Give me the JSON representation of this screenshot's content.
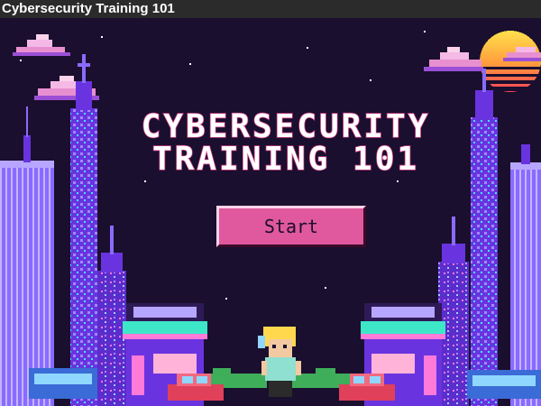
{
  "window": {
    "title": "Cybersecurity Training 101"
  },
  "game": {
    "title_line1": "CYBERSECURITY",
    "title_line2": "TRAINING 101",
    "start_label": "Start"
  },
  "colors": {
    "sky": "#1a0f2e",
    "title_text": "#ffffff",
    "title_shadow": "#d43a86",
    "button": "#e0589e",
    "sun_top": "#ffd23f",
    "sun_bottom": "#ff3d5a",
    "tower": "#7a3cff",
    "cloud": "#e88fd0"
  },
  "icons": [
    "sun-icon",
    "cloud-icon",
    "building-icon",
    "shop-icon",
    "car-icon",
    "bus-icon",
    "character-icon"
  ]
}
